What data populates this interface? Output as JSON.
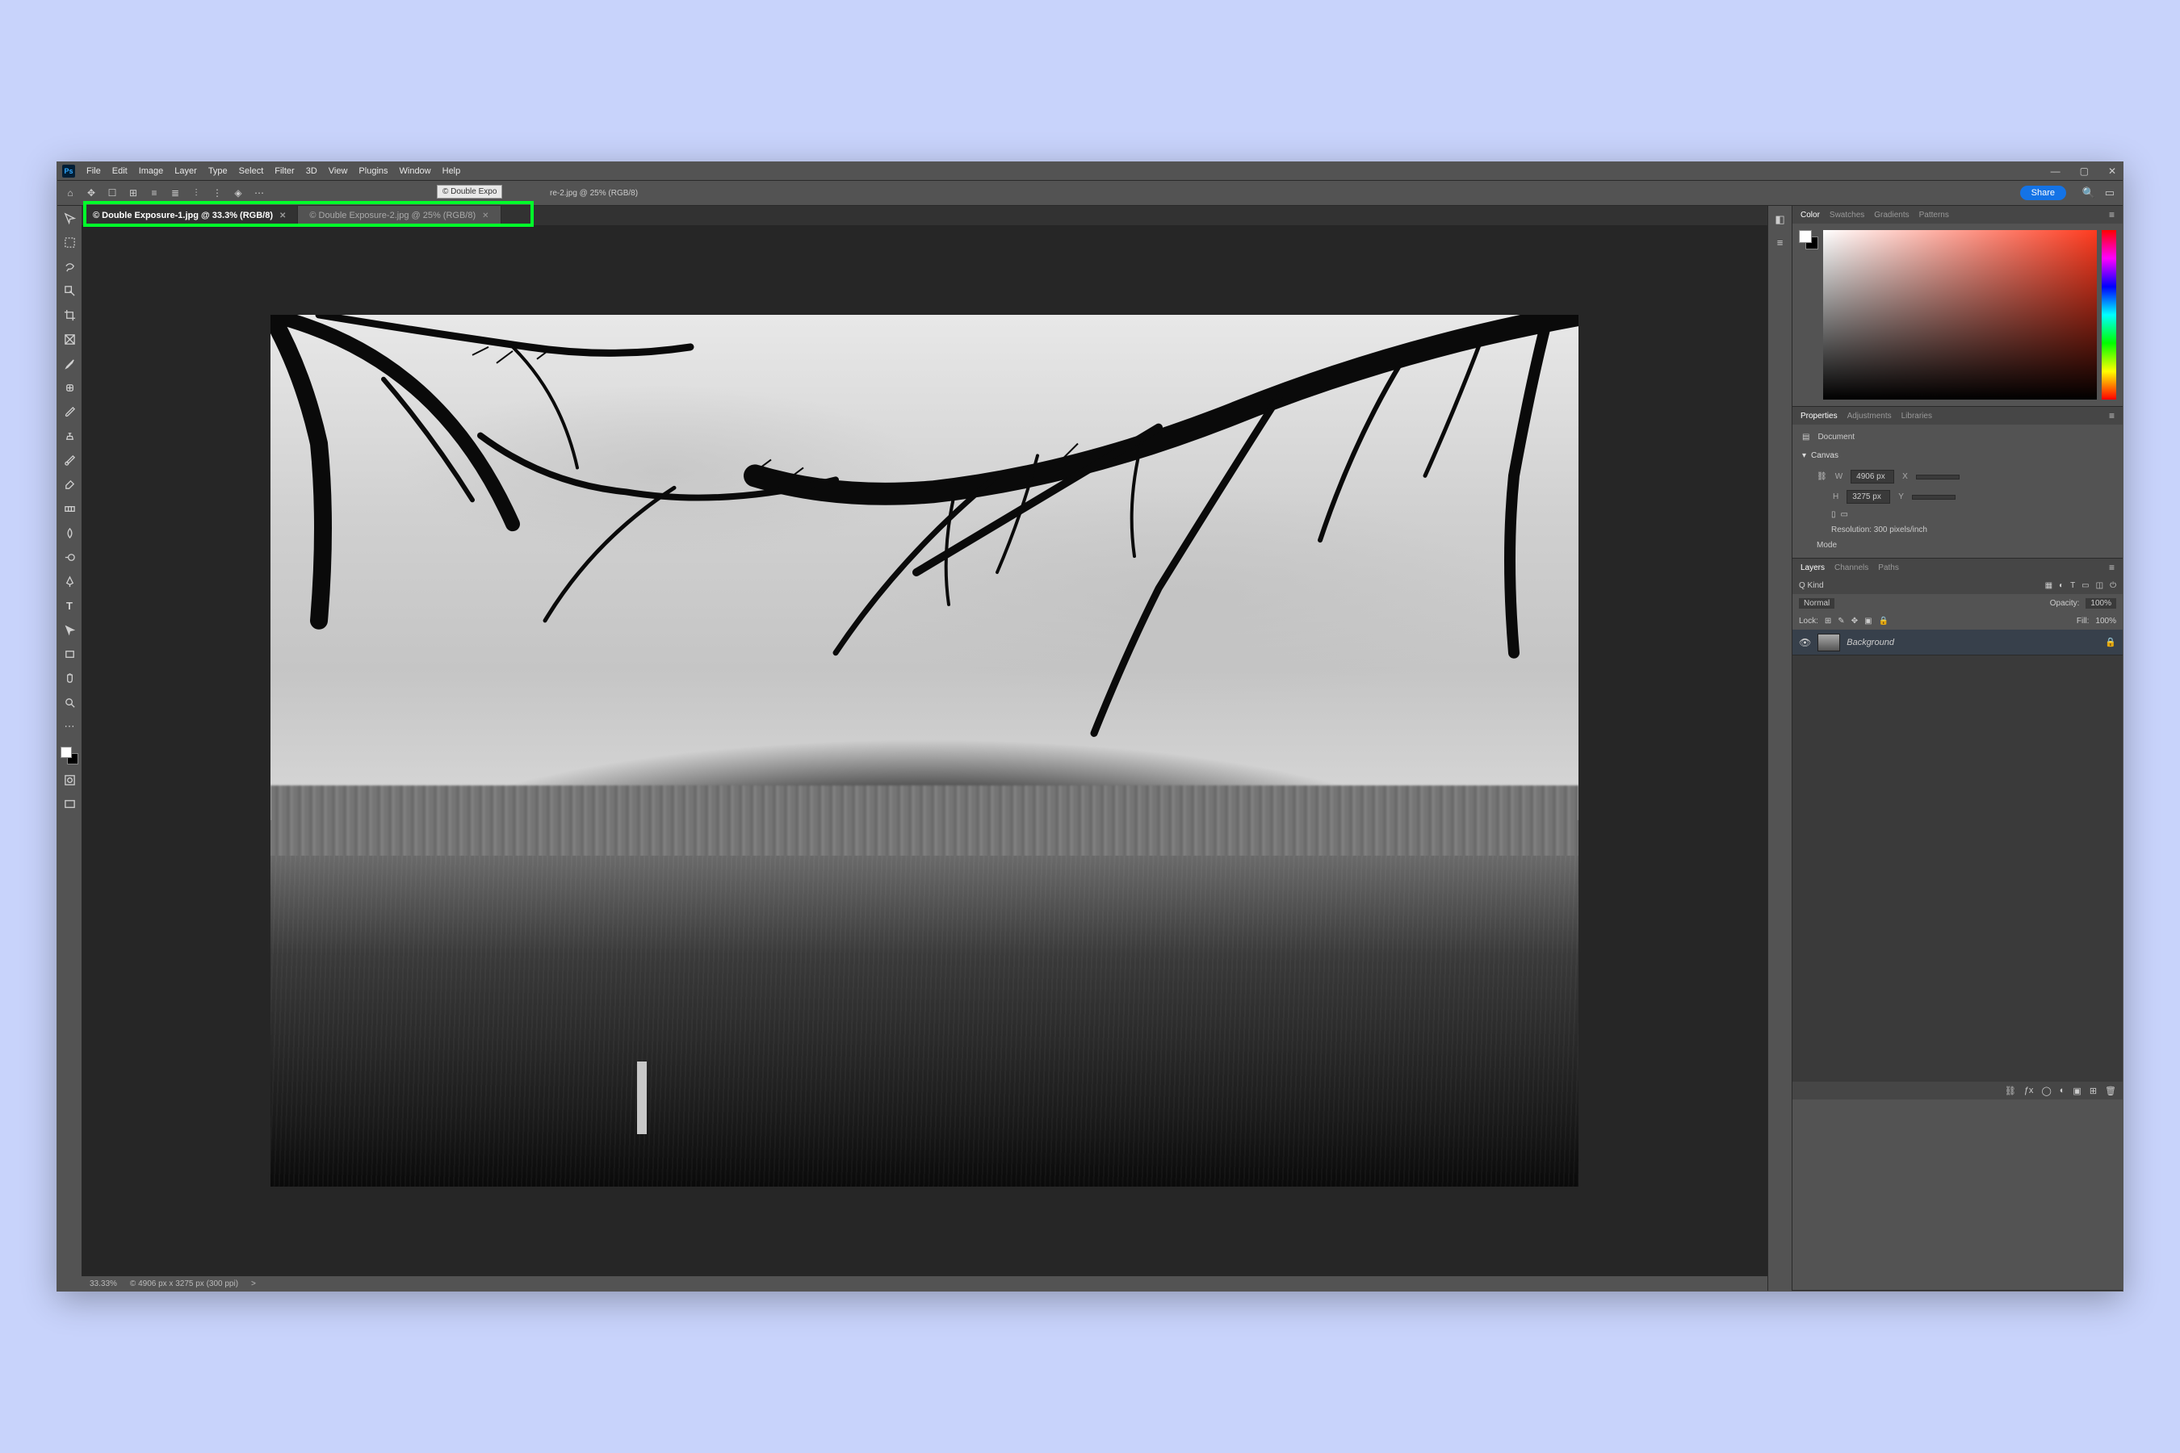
{
  "menu": {
    "items": [
      "File",
      "Edit",
      "Image",
      "Layer",
      "Type",
      "Select",
      "Filter",
      "3D",
      "View",
      "Plugins",
      "Window",
      "Help"
    ],
    "logo": "Ps"
  },
  "window_controls": {
    "min": "—",
    "max": "▢",
    "close": "✕"
  },
  "optionsbar": {
    "share": "Share",
    "tooltip": "© Double Expo"
  },
  "tabs": [
    {
      "label": "© Double Exposure-1.jpg @ 33.3% (RGB/8)",
      "active": true
    },
    {
      "label": "© Double Exposure-2.jpg @ 25% (RGB/8)",
      "active": false
    }
  ],
  "extra_tab_fragment": "re-2.jpg @ 25% (RGB/8)",
  "status": {
    "zoom": "33.33%",
    "dims": "© 4906 px x 3275 px (300 ppi)",
    "chev": ">"
  },
  "panels": {
    "color": {
      "tabs": [
        "Color",
        "Swatches",
        "Gradients",
        "Patterns"
      ],
      "active": 0
    },
    "properties": {
      "tabs": [
        "Properties",
        "Adjustments",
        "Libraries"
      ],
      "active": 0,
      "doc_label": "Document",
      "section": "Canvas",
      "w_label": "W",
      "w_value": "4906 px",
      "x_label": "X",
      "h_label": "H",
      "h_value": "3275 px",
      "y_label": "Y",
      "resolution": "Resolution: 300 pixels/inch",
      "mode": "Mode"
    },
    "layers": {
      "tabs": [
        "Layers",
        "Channels",
        "Paths"
      ],
      "active": 0,
      "kind": "Q Kind",
      "blend_mode": "Normal",
      "opacity_label": "Opacity:",
      "opacity": "100%",
      "lock_label": "Lock:",
      "fill_label": "Fill:",
      "fill": "100%",
      "layer_name": "Background"
    }
  },
  "colors": {
    "accent": "#1473e6",
    "highlight": "#00ff2a"
  }
}
